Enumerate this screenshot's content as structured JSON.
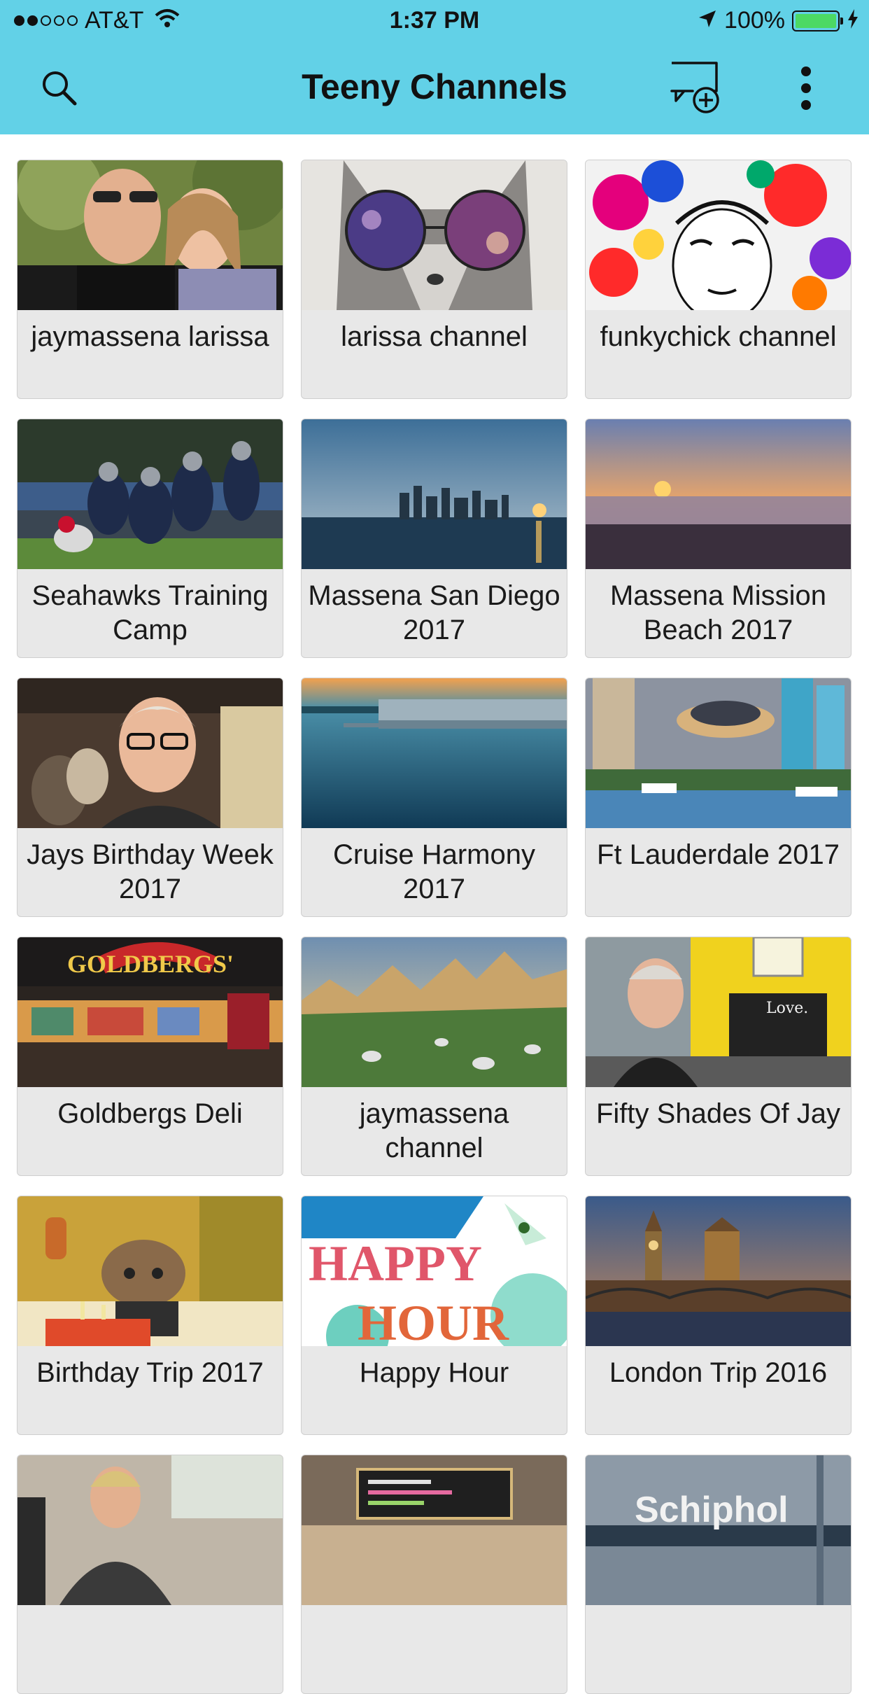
{
  "status_bar": {
    "carrier": "AT&T",
    "time": "1:37 PM",
    "battery": "100%",
    "signal_icon": "signal-dots-icon",
    "wifi_icon": "wifi-icon",
    "location_icon": "location-arrow-icon",
    "charging_icon": "charging-bolt-icon"
  },
  "header": {
    "title": "Teeny Channels",
    "background": "#62d1e7",
    "search_icon": "search-icon",
    "new_chat_icon": "chat-bubble-plus-icon",
    "menu_icon": "more-vertical-icon"
  },
  "channels": [
    {
      "title": "jaymassena larissa",
      "image": "couple-selfie-photo"
    },
    {
      "title": "larissa channel",
      "image": "cat-sunglasses-photo"
    },
    {
      "title": "funkychick channel",
      "image": "psychedelic-art-photo"
    },
    {
      "title": "Seahawks Training Camp",
      "image": "football-players-photo"
    },
    {
      "title": "Massena San Diego 2017",
      "image": "san-diego-skyline-photo"
    },
    {
      "title": "Massena Mission Beach 2017",
      "image": "beach-sunset-photo"
    },
    {
      "title": "Jays Birthday Week 2017",
      "image": "man-glasses-restaurant-photo"
    },
    {
      "title": "Cruise Harmony 2017",
      "image": "cruise-ship-photo"
    },
    {
      "title": "Ft Lauderdale 2017",
      "image": "lauderdale-waterway-photo"
    },
    {
      "title": "Goldbergs Deli",
      "image": "deli-storefront-photo"
    },
    {
      "title": "jaymassena channel",
      "image": "mountain-meadow-photo"
    },
    {
      "title": "Fifty Shades Of Jay",
      "image": "man-yellow-wall-photo"
    },
    {
      "title": "Birthday Trip 2017",
      "image": "cat-birthday-cake-photo"
    },
    {
      "title": "Happy Hour",
      "image": "happy-hour-art"
    },
    {
      "title": "London Trip 2016",
      "image": "london-parliament-photo"
    },
    {
      "title": "",
      "image": "woman-cafe-photo"
    },
    {
      "title": "",
      "image": "cafe-menu-board-photo"
    },
    {
      "title": "",
      "image": "schiphol-airport-photo"
    }
  ],
  "image_text": {
    "goldbergs_sign": "GOLDBERGS'",
    "happy": "HAPPY",
    "hour": "HOUR",
    "love": "Love.",
    "schiphol": "Schiphol"
  }
}
